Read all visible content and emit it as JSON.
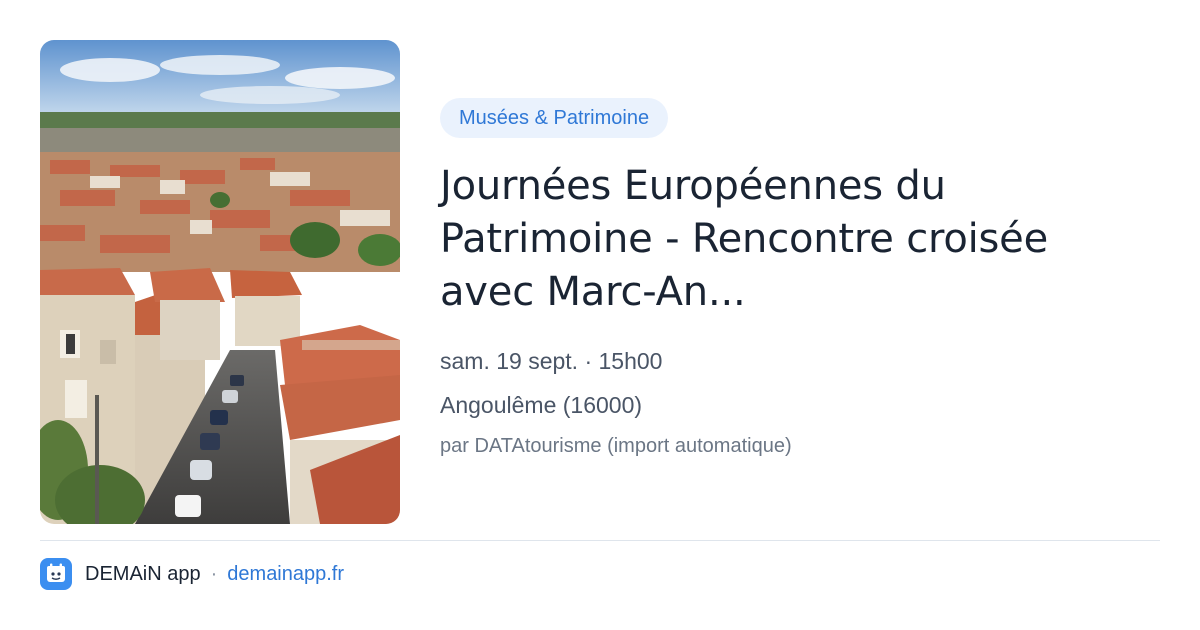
{
  "category": "Musées & Patrimoine",
  "title": "Journées Européennes du Patrimoine - Rencontre croisée avec Marc-An...",
  "date_time": "sam. 19 sept. · 15h00",
  "location": "Angoulême (16000)",
  "author": "par DATAtourisme (import automatique)",
  "footer": {
    "app_name": "DEMAiN app",
    "separator": "·",
    "link_text": "demainapp.fr"
  },
  "colors": {
    "accent": "#2f78d6",
    "badge_bg": "#eaf2fd",
    "title": "#1a2433",
    "app_icon": "#3b8ef0"
  },
  "icons": {
    "app": "demain-app-logo-icon"
  }
}
